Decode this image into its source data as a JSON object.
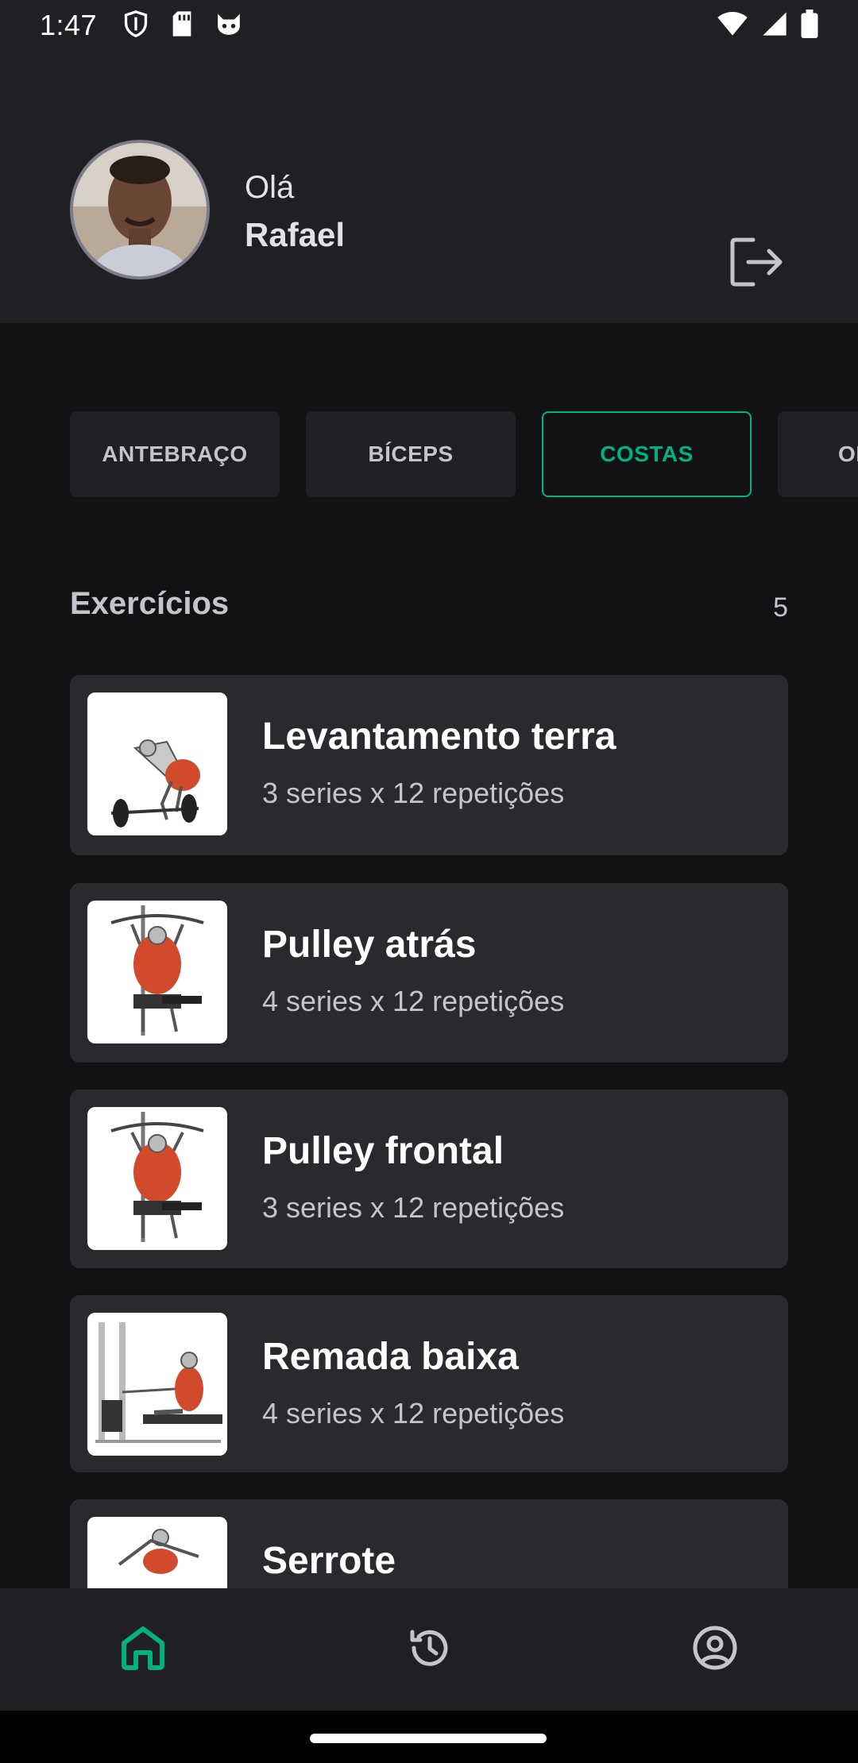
{
  "status_bar": {
    "time": "1:47"
  },
  "header": {
    "greeting": "Olá",
    "user_name": "Rafael"
  },
  "chips": [
    {
      "label": "ANTEBRAÇO",
      "active": false
    },
    {
      "label": "BÍCEPS",
      "active": false
    },
    {
      "label": "COSTAS",
      "active": true
    },
    {
      "label": "OMBROS",
      "active": false
    }
  ],
  "section": {
    "title": "Exercícios",
    "count": "5"
  },
  "exercises": [
    {
      "name": "Levantamento terra",
      "details": "3 series x 12 repetições"
    },
    {
      "name": "Pulley atrás",
      "details": "4 series x 12 repetições"
    },
    {
      "name": "Pulley frontal",
      "details": "3 series x 12 repetições"
    },
    {
      "name": "Remada baixa",
      "details": "4 series x 12 repetições"
    },
    {
      "name": "Serrote",
      "details": ""
    }
  ],
  "bottom_nav": {
    "items": [
      {
        "icon": "home-icon",
        "active": true
      },
      {
        "icon": "history-icon",
        "active": false
      },
      {
        "icon": "profile-icon",
        "active": false
      }
    ]
  },
  "colors": {
    "background": "#121214",
    "surface": "#202024",
    "card": "#29292e",
    "accent": "#00b37e",
    "text": "#e1e1e6",
    "muted": "#c4c4cc"
  }
}
